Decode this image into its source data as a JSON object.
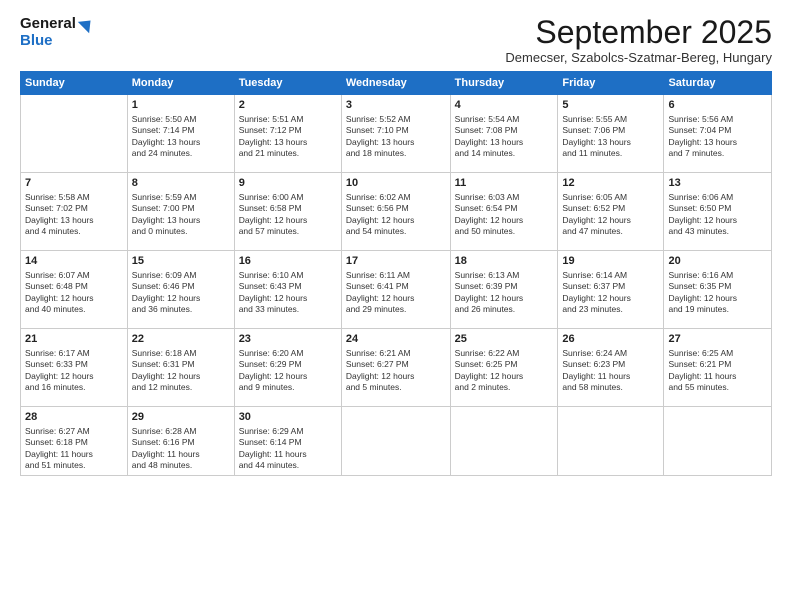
{
  "header": {
    "logo_line1": "General",
    "logo_line2": "Blue",
    "month_title": "September 2025",
    "location": "Demecser, Szabolcs-Szatmar-Bereg, Hungary"
  },
  "days_of_week": [
    "Sunday",
    "Monday",
    "Tuesday",
    "Wednesday",
    "Thursday",
    "Friday",
    "Saturday"
  ],
  "weeks": [
    [
      {
        "day": "",
        "info": ""
      },
      {
        "day": "1",
        "info": "Sunrise: 5:50 AM\nSunset: 7:14 PM\nDaylight: 13 hours\nand 24 minutes."
      },
      {
        "day": "2",
        "info": "Sunrise: 5:51 AM\nSunset: 7:12 PM\nDaylight: 13 hours\nand 21 minutes."
      },
      {
        "day": "3",
        "info": "Sunrise: 5:52 AM\nSunset: 7:10 PM\nDaylight: 13 hours\nand 18 minutes."
      },
      {
        "day": "4",
        "info": "Sunrise: 5:54 AM\nSunset: 7:08 PM\nDaylight: 13 hours\nand 14 minutes."
      },
      {
        "day": "5",
        "info": "Sunrise: 5:55 AM\nSunset: 7:06 PM\nDaylight: 13 hours\nand 11 minutes."
      },
      {
        "day": "6",
        "info": "Sunrise: 5:56 AM\nSunset: 7:04 PM\nDaylight: 13 hours\nand 7 minutes."
      }
    ],
    [
      {
        "day": "7",
        "info": "Sunrise: 5:58 AM\nSunset: 7:02 PM\nDaylight: 13 hours\nand 4 minutes."
      },
      {
        "day": "8",
        "info": "Sunrise: 5:59 AM\nSunset: 7:00 PM\nDaylight: 13 hours\nand 0 minutes."
      },
      {
        "day": "9",
        "info": "Sunrise: 6:00 AM\nSunset: 6:58 PM\nDaylight: 12 hours\nand 57 minutes."
      },
      {
        "day": "10",
        "info": "Sunrise: 6:02 AM\nSunset: 6:56 PM\nDaylight: 12 hours\nand 54 minutes."
      },
      {
        "day": "11",
        "info": "Sunrise: 6:03 AM\nSunset: 6:54 PM\nDaylight: 12 hours\nand 50 minutes."
      },
      {
        "day": "12",
        "info": "Sunrise: 6:05 AM\nSunset: 6:52 PM\nDaylight: 12 hours\nand 47 minutes."
      },
      {
        "day": "13",
        "info": "Sunrise: 6:06 AM\nSunset: 6:50 PM\nDaylight: 12 hours\nand 43 minutes."
      }
    ],
    [
      {
        "day": "14",
        "info": "Sunrise: 6:07 AM\nSunset: 6:48 PM\nDaylight: 12 hours\nand 40 minutes."
      },
      {
        "day": "15",
        "info": "Sunrise: 6:09 AM\nSunset: 6:46 PM\nDaylight: 12 hours\nand 36 minutes."
      },
      {
        "day": "16",
        "info": "Sunrise: 6:10 AM\nSunset: 6:43 PM\nDaylight: 12 hours\nand 33 minutes."
      },
      {
        "day": "17",
        "info": "Sunrise: 6:11 AM\nSunset: 6:41 PM\nDaylight: 12 hours\nand 29 minutes."
      },
      {
        "day": "18",
        "info": "Sunrise: 6:13 AM\nSunset: 6:39 PM\nDaylight: 12 hours\nand 26 minutes."
      },
      {
        "day": "19",
        "info": "Sunrise: 6:14 AM\nSunset: 6:37 PM\nDaylight: 12 hours\nand 23 minutes."
      },
      {
        "day": "20",
        "info": "Sunrise: 6:16 AM\nSunset: 6:35 PM\nDaylight: 12 hours\nand 19 minutes."
      }
    ],
    [
      {
        "day": "21",
        "info": "Sunrise: 6:17 AM\nSunset: 6:33 PM\nDaylight: 12 hours\nand 16 minutes."
      },
      {
        "day": "22",
        "info": "Sunrise: 6:18 AM\nSunset: 6:31 PM\nDaylight: 12 hours\nand 12 minutes."
      },
      {
        "day": "23",
        "info": "Sunrise: 6:20 AM\nSunset: 6:29 PM\nDaylight: 12 hours\nand 9 minutes."
      },
      {
        "day": "24",
        "info": "Sunrise: 6:21 AM\nSunset: 6:27 PM\nDaylight: 12 hours\nand 5 minutes."
      },
      {
        "day": "25",
        "info": "Sunrise: 6:22 AM\nSunset: 6:25 PM\nDaylight: 12 hours\nand 2 minutes."
      },
      {
        "day": "26",
        "info": "Sunrise: 6:24 AM\nSunset: 6:23 PM\nDaylight: 11 hours\nand 58 minutes."
      },
      {
        "day": "27",
        "info": "Sunrise: 6:25 AM\nSunset: 6:21 PM\nDaylight: 11 hours\nand 55 minutes."
      }
    ],
    [
      {
        "day": "28",
        "info": "Sunrise: 6:27 AM\nSunset: 6:18 PM\nDaylight: 11 hours\nand 51 minutes."
      },
      {
        "day": "29",
        "info": "Sunrise: 6:28 AM\nSunset: 6:16 PM\nDaylight: 11 hours\nand 48 minutes."
      },
      {
        "day": "30",
        "info": "Sunrise: 6:29 AM\nSunset: 6:14 PM\nDaylight: 11 hours\nand 44 minutes."
      },
      {
        "day": "",
        "info": ""
      },
      {
        "day": "",
        "info": ""
      },
      {
        "day": "",
        "info": ""
      },
      {
        "day": "",
        "info": ""
      }
    ]
  ]
}
